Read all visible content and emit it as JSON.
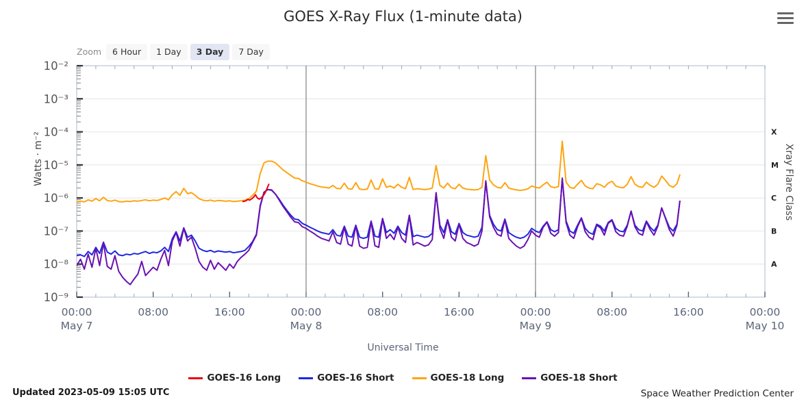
{
  "header": {
    "title": "GOES X-Ray Flux (1-minute data)",
    "menu_icon": "hamburger-menu-icon"
  },
  "zoom_control": {
    "label": "Zoom",
    "options": [
      "6 Hour",
      "1 Day",
      "3 Day",
      "7 Day"
    ],
    "selected": "3 Day"
  },
  "footer": {
    "updated": "Updated 2023-05-09 15:05 UTC",
    "source": "Space Weather Prediction Center"
  },
  "colors": {
    "goes16_long": "#e8000d",
    "goes16_short": "#1f27e0",
    "goes18_long": "#ffa410",
    "goes18_short": "#6a11b0",
    "grid": "#e4e4e4",
    "axis": "#c8d0de",
    "daysep": "#808080"
  },
  "chart_data": {
    "type": "line",
    "title": "GOES X-Ray Flux (1-minute data)",
    "xlabel": "Universal Time",
    "ylabel": "Watts · m⁻²",
    "y2label": "Xray Flare Class",
    "grid": true,
    "legend_position": "bottom",
    "yscale": "log",
    "ylim": [
      1e-09,
      0.01
    ],
    "ytick_labels": [
      "10⁻²",
      "10⁻³",
      "10⁻⁴",
      "10⁻⁵",
      "10⁻⁶",
      "10⁻⁷",
      "10⁻⁸",
      "10⁻⁹"
    ],
    "ytick_values": [
      0.01,
      0.001,
      0.0001,
      1e-05,
      1e-06,
      1e-07,
      1e-08,
      1e-09
    ],
    "flare_class_labels": [
      "X",
      "M",
      "C",
      "B",
      "A"
    ],
    "flare_class_values": [
      0.0001,
      1e-05,
      1e-06,
      1e-07,
      1e-08
    ],
    "xlim_hours": [
      0,
      72
    ],
    "xtick_labels": [
      "00:00",
      "08:00",
      "16:00",
      "00:00",
      "08:00",
      "16:00",
      "00:00",
      "08:00",
      "16:00",
      "00:00"
    ],
    "xtick_hours": [
      0,
      8,
      16,
      24,
      32,
      40,
      48,
      56,
      64,
      72
    ],
    "xtick_day_labels": [
      "May 7",
      "",
      "",
      "May 8",
      "",
      "",
      "May 9",
      "",
      "",
      "May 10"
    ],
    "day_separator_hours": [
      24,
      48
    ],
    "data_end_hour": 63.1,
    "series": [
      {
        "name": "GOES-16 Long",
        "color": "#e8000d",
        "x": [
          17.4,
          17.7,
          17.9,
          18.1,
          18.3,
          18.5,
          18.7,
          18.9,
          19.1,
          19.3,
          19.5,
          19.7,
          19.9,
          20.1
        ],
        "values": [
          7.8e-07,
          8.2e-07,
          9e-07,
          8.6e-07,
          9.4e-07,
          1.05e-06,
          1.25e-06,
          1e-06,
          9.2e-07,
          1e-06,
          1.15e-06,
          1.4e-06,
          1.9e-06,
          2.6e-06
        ]
      },
      {
        "name": "GOES-16 Short",
        "color": "#1f27e0",
        "x": [
          0,
          0.4,
          0.8,
          1.2,
          1.6,
          2,
          2.4,
          2.8,
          3.2,
          3.6,
          4,
          4.4,
          4.8,
          5.2,
          5.6,
          6,
          6.4,
          6.8,
          7.2,
          7.6,
          8,
          8.4,
          8.8,
          9.2,
          9.6,
          10,
          10.4,
          10.8,
          11.2,
          11.6,
          12,
          12.4,
          12.8,
          13.2,
          13.6,
          14,
          14.4,
          14.8,
          15.2,
          15.6,
          16,
          16.4,
          16.8,
          17.2,
          17.6,
          18,
          18.4,
          18.8,
          19.2,
          19.6,
          20,
          20.4,
          20.8,
          21.2,
          21.6,
          22,
          22.4,
          22.8,
          23.2,
          23.6,
          24,
          24.4,
          24.8,
          25.2,
          25.6,
          26,
          26.4,
          26.8,
          27.2,
          27.6,
          28,
          28.4,
          28.8,
          29.2,
          29.6,
          30,
          30.4,
          30.8,
          31.2,
          31.6,
          32,
          32.4,
          32.8,
          33.2,
          33.6,
          34,
          34.4,
          34.8,
          35.2,
          35.6,
          36,
          36.4,
          36.8,
          37.2,
          37.6,
          38,
          38.4,
          38.8,
          39.2,
          39.6,
          40,
          40.4,
          40.8,
          41.2,
          41.6,
          42,
          42.4,
          42.8,
          43.2,
          43.6,
          44,
          44.4,
          44.8,
          45.2,
          45.6,
          46,
          46.4,
          46.8,
          47.2,
          47.6,
          48,
          48.4,
          48.8,
          49.2,
          49.6,
          50,
          50.4,
          50.8,
          51.2,
          51.6,
          52,
          52.4,
          52.8,
          53.2,
          53.6,
          54,
          54.4,
          54.8,
          55.2,
          55.6,
          56,
          56.4,
          56.8,
          57.2,
          57.6,
          58,
          58.4,
          58.8,
          59.2,
          59.6,
          60,
          60.4,
          60.8,
          61.2,
          61.6,
          62,
          62.4,
          62.8,
          63.1
        ],
        "values": [
          1.8e-08,
          1.9e-08,
          1.7e-08,
          2.4e-08,
          1.9e-08,
          3.2e-08,
          2.1e-08,
          4.6e-08,
          2.3e-08,
          2e-08,
          2.5e-08,
          1.9e-08,
          1.8e-08,
          2e-08,
          1.9e-08,
          2.1e-08,
          2e-08,
          2.2e-08,
          2.4e-08,
          2.1e-08,
          2.3e-08,
          2.2e-08,
          2.5e-08,
          3.2e-08,
          2.4e-08,
          5.8e-08,
          9.5e-08,
          5e-08,
          1.25e-07,
          6.5e-08,
          7.5e-08,
          5e-08,
          3e-08,
          2.6e-08,
          2.4e-08,
          2.6e-08,
          2.3e-08,
          2.5e-08,
          2.4e-08,
          2.3e-08,
          2.4e-08,
          2.2e-08,
          2.3e-08,
          2.4e-08,
          2.6e-08,
          3.4e-08,
          4.8e-08,
          8e-08,
          6e-07,
          1.5e-06,
          1.8e-06,
          1.7e-06,
          1.3e-06,
          9e-07,
          6e-07,
          4.2e-07,
          3e-07,
          2.3e-07,
          2.2e-07,
          1.7e-07,
          1.5e-07,
          1.3e-07,
          1.15e-07,
          1e-07,
          9e-08,
          8.5e-08,
          8e-08,
          1.1e-07,
          7.5e-08,
          7e-08,
          1.4e-07,
          7e-08,
          6.5e-08,
          1.5e-07,
          6.5e-08,
          6e-08,
          6.5e-08,
          2e-07,
          7e-08,
          6.5e-08,
          2.4e-07,
          9e-08,
          1.1e-07,
          8.5e-08,
          1.4e-07,
          9e-08,
          7.5e-08,
          3e-07,
          6.8e-08,
          7.5e-08,
          7e-08,
          6.5e-08,
          6.8e-08,
          8.5e-08,
          1.4e-06,
          1.5e-07,
          9e-08,
          2.2e-07,
          9.5e-08,
          8e-08,
          1.7e-07,
          9e-08,
          7.5e-08,
          7e-08,
          6.5e-08,
          7e-08,
          1.3e-07,
          3.1e-06,
          3e-07,
          1.6e-07,
          1.1e-07,
          1e-07,
          2.3e-07,
          9e-08,
          7.5e-08,
          6.5e-08,
          6e-08,
          6.5e-08,
          8e-08,
          1.2e-07,
          1e-07,
          9e-08,
          1.4e-07,
          1.9e-07,
          1.1e-07,
          9.5e-08,
          1.1e-07,
          3.8e-06,
          2e-07,
          1e-07,
          8.5e-08,
          1.5e-07,
          2.5e-07,
          1.2e-07,
          9e-08,
          8e-08,
          1.6e-07,
          1.4e-07,
          1e-07,
          1.8e-07,
          2.2e-07,
          1.2e-07,
          1e-07,
          9.5e-08,
          1.5e-07,
          4e-07,
          1.5e-07,
          1.1e-07,
          1e-07,
          2e-07,
          1.3e-07,
          1e-07,
          1.5e-07,
          5e-07,
          2.5e-07,
          1.3e-07,
          1e-07,
          1.6e-07,
          8e-07,
          1.8e-07
        ]
      },
      {
        "name": "GOES-18 Long",
        "color": "#ffa410",
        "x": [
          0,
          0.4,
          0.8,
          1.2,
          1.6,
          2,
          2.4,
          2.8,
          3.2,
          3.6,
          4,
          4.4,
          4.8,
          5.2,
          5.6,
          6,
          6.4,
          6.8,
          7.2,
          7.6,
          8,
          8.4,
          8.8,
          9.2,
          9.6,
          10,
          10.4,
          10.8,
          11.2,
          11.6,
          12,
          12.4,
          12.8,
          13.2,
          13.6,
          14,
          14.4,
          14.8,
          15.2,
          15.6,
          16,
          16.4,
          16.8,
          17.2,
          17.6,
          18,
          18.4,
          18.8,
          19.2,
          19.6,
          20,
          20.4,
          20.8,
          21.2,
          21.6,
          22,
          22.4,
          22.8,
          23.2,
          23.6,
          24,
          24.4,
          24.8,
          25.2,
          25.6,
          26,
          26.4,
          26.8,
          27.2,
          27.6,
          28,
          28.4,
          28.8,
          29.2,
          29.6,
          30,
          30.4,
          30.8,
          31.2,
          31.6,
          32,
          32.4,
          32.8,
          33.2,
          33.6,
          34,
          34.4,
          34.8,
          35.2,
          35.6,
          36,
          36.4,
          36.8,
          37.2,
          37.6,
          38,
          38.4,
          38.8,
          39.2,
          39.6,
          40,
          40.4,
          40.8,
          41.2,
          41.6,
          42,
          42.4,
          42.8,
          43.2,
          43.6,
          44,
          44.4,
          44.8,
          45.2,
          45.6,
          46,
          46.4,
          46.8,
          47.2,
          47.6,
          48,
          48.4,
          48.8,
          49.2,
          49.6,
          50,
          50.4,
          50.8,
          51.2,
          51.6,
          52,
          52.4,
          52.8,
          53.2,
          53.6,
          54,
          54.4,
          54.8,
          55.2,
          55.6,
          56,
          56.4,
          56.8,
          57.2,
          57.6,
          58,
          58.4,
          58.8,
          59.2,
          59.6,
          60,
          60.4,
          60.8,
          61.2,
          61.6,
          62,
          62.4,
          62.8,
          63.1
        ],
        "values": [
          7.8e-07,
          8e-07,
          7.6e-07,
          8.8e-07,
          8e-07,
          9.6e-07,
          8.2e-07,
          1.05e-06,
          8.4e-07,
          8e-07,
          8.6e-07,
          7.8e-07,
          7.6e-07,
          8e-07,
          7.8e-07,
          8.2e-07,
          8e-07,
          8.4e-07,
          8.8e-07,
          8.2e-07,
          8.6e-07,
          8.4e-07,
          9e-07,
          1e-06,
          8.8e-07,
          1.25e-06,
          1.55e-06,
          1.2e-06,
          1.95e-06,
          1.35e-06,
          1.45e-06,
          1.2e-06,
          9.5e-07,
          8.6e-07,
          8.2e-07,
          8.6e-07,
          8e-07,
          8.4e-07,
          8.2e-07,
          8e-07,
          8.2e-07,
          7.8e-07,
          8e-07,
          8.2e-07,
          8.6e-07,
          9.5e-07,
          1.2e-06,
          1.6e-06,
          5.5e-06,
          1.15e-05,
          1.3e-05,
          1.3e-05,
          1.15e-05,
          9e-06,
          7e-06,
          5.8e-06,
          4.8e-06,
          4e-06,
          3.9e-06,
          3.3e-06,
          3e-06,
          2.7e-06,
          2.5e-06,
          2.3e-06,
          2.15e-06,
          2.1e-06,
          2e-06,
          2.4e-06,
          1.95e-06,
          1.9e-06,
          2.8e-06,
          1.9e-06,
          1.85e-06,
          2.9e-06,
          1.85e-06,
          1.8e-06,
          1.85e-06,
          3.5e-06,
          1.9e-06,
          1.85e-06,
          3.8e-06,
          2.1e-06,
          2.3e-06,
          2e-06,
          2.6e-06,
          2.1e-06,
          1.9e-06,
          4.2e-06,
          1.8e-06,
          1.9e-06,
          1.85e-06,
          1.8e-06,
          1.85e-06,
          2e-06,
          9.5e-06,
          2.4e-06,
          2e-06,
          2.8e-06,
          2.05e-06,
          1.9e-06,
          2.6e-06,
          2e-06,
          1.85e-06,
          1.8e-06,
          1.75e-06,
          1.8e-06,
          2.1e-06,
          1.9e-05,
          3.5e-06,
          2.5e-06,
          2.1e-06,
          2e-06,
          2.9e-06,
          2e-06,
          1.85e-06,
          1.75e-06,
          1.7e-06,
          1.75e-06,
          1.9e-06,
          2.3e-06,
          2.1e-06,
          2e-06,
          2.5e-06,
          3e-06,
          2.2e-06,
          2.05e-06,
          2.2e-06,
          5.2e-05,
          3e-06,
          2.1e-06,
          1.95e-06,
          2.6e-06,
          3.4e-06,
          2.3e-06,
          2e-06,
          1.9e-06,
          2.7e-06,
          2.5e-06,
          2.1e-06,
          2.8e-06,
          3.2e-06,
          2.3e-06,
          2.1e-06,
          2.05e-06,
          2.6e-06,
          4.4e-06,
          2.6e-06,
          2.2e-06,
          2.1e-06,
          3e-06,
          2.4e-06,
          2.1e-06,
          2.6e-06,
          4.6e-06,
          3.4e-06,
          2.4e-06,
          2.1e-06,
          2.7e-06,
          5e-06,
          3.6e-06
        ]
      },
      {
        "name": "GOES-18 Short",
        "color": "#6a11b0",
        "x": [
          0,
          0.4,
          0.8,
          1.2,
          1.6,
          2,
          2.4,
          2.8,
          3.2,
          3.6,
          4,
          4.4,
          4.8,
          5.2,
          5.6,
          6,
          6.4,
          6.8,
          7.2,
          7.6,
          8,
          8.4,
          8.8,
          9.2,
          9.6,
          10,
          10.4,
          10.8,
          11.2,
          11.6,
          12,
          12.4,
          12.8,
          13.2,
          13.6,
          14,
          14.4,
          14.8,
          15.2,
          15.6,
          16,
          16.4,
          16.8,
          17.2,
          17.6,
          18,
          18.4,
          18.8,
          19.2,
          19.6,
          20,
          20.4,
          20.8,
          21.2,
          21.6,
          22,
          22.4,
          22.8,
          23.2,
          23.6,
          24,
          24.4,
          24.8,
          25.2,
          25.6,
          26,
          26.4,
          26.8,
          27.2,
          27.6,
          28,
          28.4,
          28.8,
          29.2,
          29.6,
          30,
          30.4,
          30.8,
          31.2,
          31.6,
          32,
          32.4,
          32.8,
          33.2,
          33.6,
          34,
          34.4,
          34.8,
          35.2,
          35.6,
          36,
          36.4,
          36.8,
          37.2,
          37.6,
          38,
          38.4,
          38.8,
          39.2,
          39.6,
          40,
          40.4,
          40.8,
          41.2,
          41.6,
          42,
          42.4,
          42.8,
          43.2,
          43.6,
          44,
          44.4,
          44.8,
          45.2,
          45.6,
          46,
          46.4,
          46.8,
          47.2,
          47.6,
          48,
          48.4,
          48.8,
          49.2,
          49.6,
          50,
          50.4,
          50.8,
          51.2,
          51.6,
          52,
          52.4,
          52.8,
          53.2,
          53.6,
          54,
          54.4,
          54.8,
          55.2,
          55.6,
          56,
          56.4,
          56.8,
          57.2,
          57.6,
          58,
          58.4,
          58.8,
          59.2,
          59.6,
          60,
          60.4,
          60.8,
          61.2,
          61.6,
          62,
          62.4,
          62.8,
          63.1
        ],
        "values": [
          9e-09,
          1.4e-08,
          7e-09,
          2e-08,
          8e-09,
          3e-08,
          9e-09,
          4.4e-08,
          8.5e-09,
          7e-09,
          1.8e-08,
          6e-09,
          4e-09,
          3e-09,
          2.4e-09,
          3.5e-09,
          5e-09,
          1.2e-08,
          4.5e-09,
          6e-09,
          8e-09,
          6.5e-09,
          1.4e-08,
          2.6e-08,
          9e-09,
          5e-08,
          9e-08,
          3.5e-08,
          1.2e-07,
          5e-08,
          6.5e-08,
          3e-08,
          1.2e-08,
          8e-09,
          6.5e-09,
          1.3e-08,
          7e-09,
          1.1e-08,
          8.5e-09,
          6.5e-09,
          1e-08,
          7.5e-09,
          1.2e-08,
          1.6e-08,
          2e-08,
          2.6e-08,
          4.5e-08,
          7.5e-08,
          5.5e-07,
          1.5e-06,
          1.8e-06,
          1.75e-06,
          1.3e-06,
          8.5e-07,
          5.5e-07,
          3.8e-07,
          2.6e-07,
          1.9e-07,
          1.8e-07,
          1.35e-07,
          1.2e-07,
          1e-07,
          8.5e-08,
          7e-08,
          6e-08,
          5.5e-08,
          5e-08,
          9.5e-08,
          4.5e-08,
          4e-08,
          1.3e-07,
          4e-08,
          3.5e-08,
          1.45e-07,
          3.5e-08,
          3e-08,
          3.2e-08,
          1.95e-07,
          3.6e-08,
          3.2e-08,
          2.35e-07,
          6e-08,
          8e-08,
          5.5e-08,
          1.3e-07,
          6e-08,
          4.5e-08,
          2.95e-07,
          3.8e-08,
          4.5e-08,
          4e-08,
          3.5e-08,
          3.8e-08,
          5.5e-08,
          1.45e-06,
          1.2e-07,
          6e-08,
          2.1e-07,
          6.5e-08,
          5e-08,
          1.6e-07,
          6e-08,
          4.5e-08,
          4e-08,
          3.5e-08,
          4e-08,
          1e-07,
          3.3e-06,
          2.7e-07,
          1.3e-07,
          8e-08,
          7e-08,
          2.2e-07,
          6e-08,
          4.5e-08,
          3.5e-08,
          3e-08,
          3.5e-08,
          5.5e-08,
          1e-07,
          7.5e-08,
          6.5e-08,
          1.3e-07,
          1.85e-07,
          8.5e-08,
          7e-08,
          9e-08,
          4e-06,
          1.8e-07,
          7.5e-08,
          6e-08,
          1.35e-07,
          2.4e-07,
          9.5e-08,
          6.5e-08,
          5.5e-08,
          1.5e-07,
          1.25e-07,
          7.5e-08,
          1.7e-07,
          2.1e-07,
          9.5e-08,
          7.5e-08,
          7e-08,
          1.4e-07,
          4e-07,
          1.35e-07,
          8.5e-08,
          7.5e-08,
          1.9e-07,
          1.1e-07,
          7.5e-08,
          1.4e-07,
          5e-07,
          2.4e-07,
          1.1e-07,
          7e-08,
          1.5e-07,
          8e-07,
          1.6e-07
        ]
      }
    ]
  }
}
